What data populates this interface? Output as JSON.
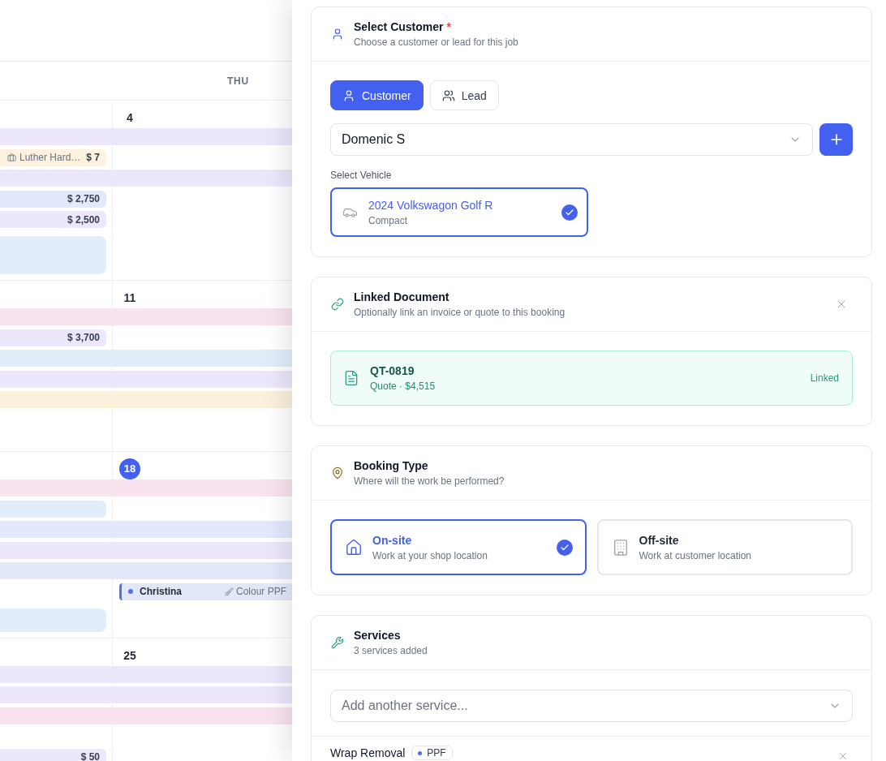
{
  "calendar": {
    "day_header": "THU",
    "weeks": [
      {
        "date": "4",
        "today": false,
        "lanes": [
          {
            "kind": "bar",
            "color": "#ece7fb"
          },
          {
            "kind": "chip",
            "color": "#fdf1df",
            "title": "Luther Hard…",
            "amount": "$ 7"
          },
          {
            "kind": "bar",
            "color": "#ece7fb"
          },
          {
            "kind": "chip",
            "color": "#e3e8fb",
            "amount": "$ 2,750"
          },
          {
            "kind": "chip",
            "color": "#ece7fb",
            "amount": "$ 2,500"
          },
          {
            "kind": "block",
            "tall": true,
            "color": "#e1eefa"
          }
        ]
      },
      {
        "date": "11",
        "today": false,
        "lanes": [
          {
            "kind": "bar",
            "color": "#f9e3ef"
          },
          {
            "kind": "chip",
            "color": "#ece7fb",
            "amount": "$ 3,700"
          },
          {
            "kind": "bar",
            "color": "#e1eefa"
          },
          {
            "kind": "bar",
            "color": "#ece7fb"
          },
          {
            "kind": "bar",
            "color": "#fbf0dc"
          }
        ]
      },
      {
        "date": "18",
        "today": true,
        "lanes": [
          {
            "kind": "bar",
            "color": "#f9e3ef"
          },
          {
            "kind": "chip",
            "color": "#e1eefa"
          },
          {
            "kind": "bar",
            "color": "#e3e8fb"
          },
          {
            "kind": "bar",
            "color": "#ece7fb"
          },
          {
            "kind": "bar",
            "color": "#e3e8fb"
          },
          {
            "kind": "entry",
            "color": "#4f6ef7",
            "customer": "Christina",
            "service": "Colour PPF"
          },
          {
            "kind": "block",
            "tall": false,
            "color": "#e1eefa"
          }
        ]
      },
      {
        "date": "25",
        "today": false,
        "lanes": [
          {
            "kind": "bar",
            "color": "#ece7fb"
          },
          {
            "kind": "bar",
            "color": "#ece7fb"
          },
          {
            "kind": "bar",
            "color": "#f9e3ef"
          },
          {
            "kind": "blank"
          },
          {
            "kind": "chip",
            "color": "#ece7fb",
            "amount": "$ 50"
          }
        ]
      }
    ]
  },
  "booking_form": {
    "customer_section": {
      "title": "Select Customer",
      "required_mark": "*",
      "subtitle": "Choose a customer or lead for this job",
      "mode_tabs": [
        {
          "kind": "customer",
          "label": "Customer",
          "selected": true
        },
        {
          "kind": "lead",
          "label": "Lead",
          "selected": false
        }
      ],
      "customer_select": {
        "value": "Domenic S"
      },
      "vehicle_label": "Select Vehicle",
      "vehicles": [
        {
          "name": "2024 Volkswagon Golf R",
          "class": "Compact",
          "selected": true
        }
      ]
    },
    "linked_document": {
      "title": "Linked Document",
      "subtitle": "Optionally link an invoice or quote to this booking",
      "document": {
        "number": "QT-0819",
        "details": "Quote · $4,515",
        "status": "Linked"
      }
    },
    "booking_type": {
      "title": "Booking Type",
      "subtitle": "Where will the work be performed?",
      "options": [
        {
          "kind": "onsite",
          "label": "On-site",
          "description": "Work at your shop location",
          "selected": true
        },
        {
          "kind": "offsite",
          "label": "Off-site",
          "description": "Work at customer location",
          "selected": false
        }
      ]
    },
    "services": {
      "title": "Services",
      "subtitle": "3 services added",
      "add_select": {
        "placeholder": "Add another service..."
      },
      "items": [
        {
          "name": "Wrap Removal",
          "tag": "PPF"
        }
      ]
    }
  }
}
